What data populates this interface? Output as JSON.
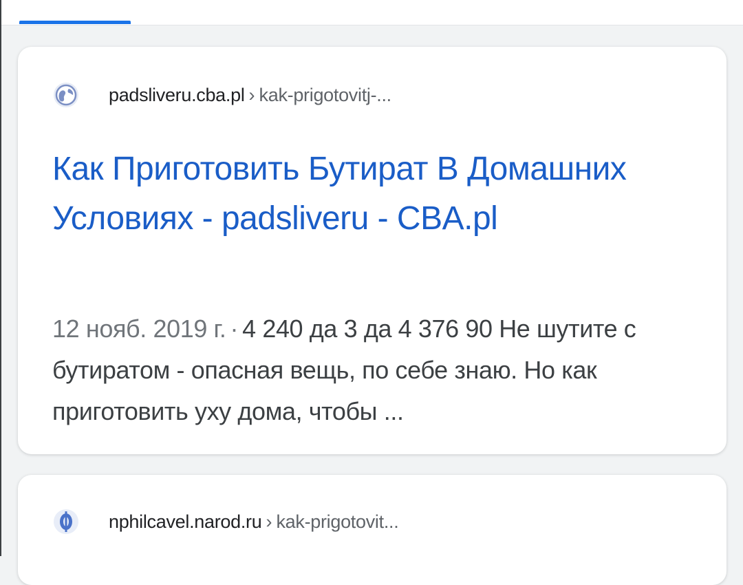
{
  "results": [
    {
      "domain": "padsliveru.cba.pl",
      "separator": "›",
      "path": "kak-prigotovitj-...",
      "title": "Как Приготовить Бутират В Домашних Условиях - padsliveru - CBA.pl",
      "date": "12 нояб. 2019 г.",
      "dot": "·",
      "snippet": "4 240 да 3 да 4 376 90 Не шутите с бутиратом - опасная вещь, по себе знаю. Но как приготовить уху дома, чтобы ...",
      "favicon_icon": "globe-icon"
    },
    {
      "domain": "nphilcavel.narod.ru",
      "separator": "›",
      "path": "kak-prigotovit...",
      "favicon_icon": "phi-icon"
    }
  ],
  "colors": {
    "title_link": "#1a5dc7",
    "tab_indicator": "#1a73e8",
    "background": "#f1f3f4",
    "card": "#ffffff"
  }
}
